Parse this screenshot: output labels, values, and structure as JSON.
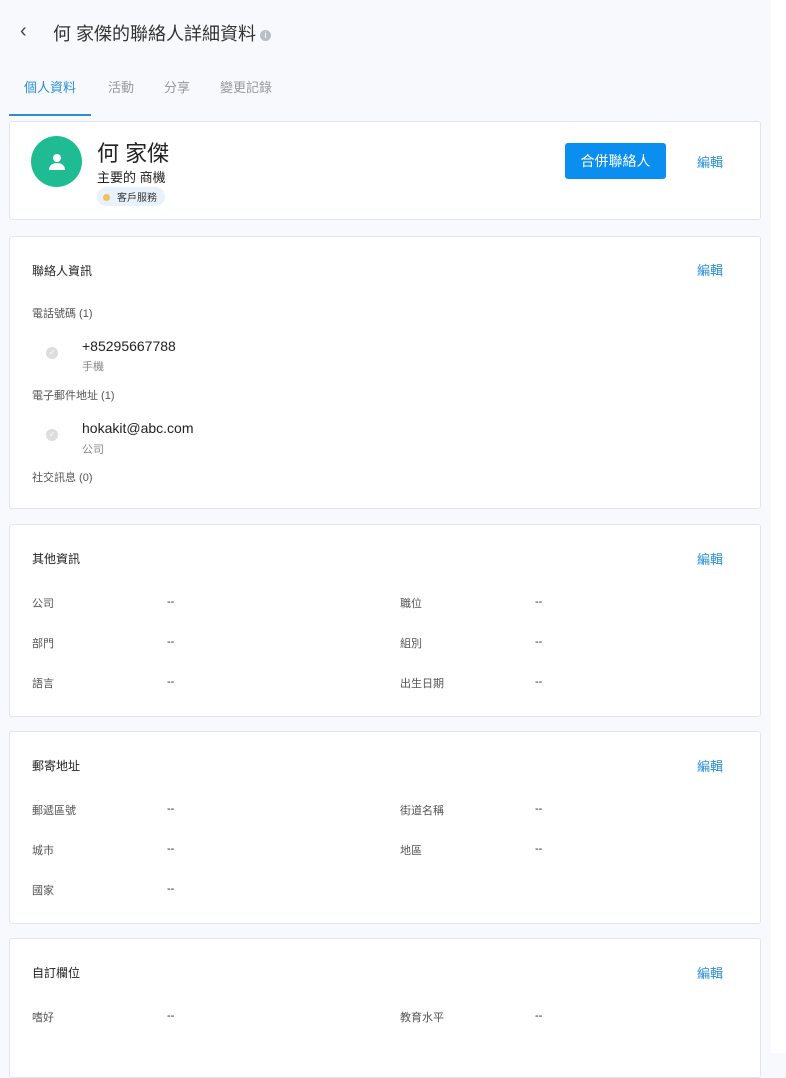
{
  "header": {
    "title": "何 家傑的聯絡人詳細資料",
    "back": "‹"
  },
  "tabs": [
    {
      "label": "個人資料"
    },
    {
      "label": "活動"
    },
    {
      "label": "分享"
    },
    {
      "label": "變更記錄"
    }
  ],
  "profile": {
    "name": "何 家傑",
    "subtitle": "主要的 商機",
    "badge": "客戶服務",
    "merge_label": "合併聯絡人",
    "edit_label": "編輯"
  },
  "contact": {
    "title": "聯絡人資訊",
    "edit": "編輯",
    "phone_label": "電話號碼 (1)",
    "phone": "+85295667788",
    "phone_type": "手機",
    "email_label": "電子郵件地址 (1)",
    "email": "hokakit@abc.com",
    "email_type": "公司",
    "social_label": "社交訊息 (0)"
  },
  "other": {
    "title": "其他資訊",
    "edit": "編輯",
    "fields": [
      {
        "label": "公司",
        "value": "--"
      },
      {
        "label": "職位",
        "value": "--"
      },
      {
        "label": "部門",
        "value": "--"
      },
      {
        "label": "組別",
        "value": "--"
      },
      {
        "label": "語言",
        "value": "--"
      },
      {
        "label": "出生日期",
        "value": "--"
      }
    ]
  },
  "address": {
    "title": "郵寄地址",
    "edit": "編輯",
    "fields": [
      {
        "label": "郵遞區號",
        "value": "--"
      },
      {
        "label": "街道名稱",
        "value": "--"
      },
      {
        "label": "城市",
        "value": "--"
      },
      {
        "label": "地區",
        "value": "--"
      },
      {
        "label": "國家",
        "value": "--"
      }
    ]
  },
  "custom": {
    "title": "自訂欄位",
    "edit": "編輯",
    "fields": [
      {
        "label": "嗜好",
        "value": "--"
      },
      {
        "label": "教育水平",
        "value": "--"
      }
    ]
  }
}
